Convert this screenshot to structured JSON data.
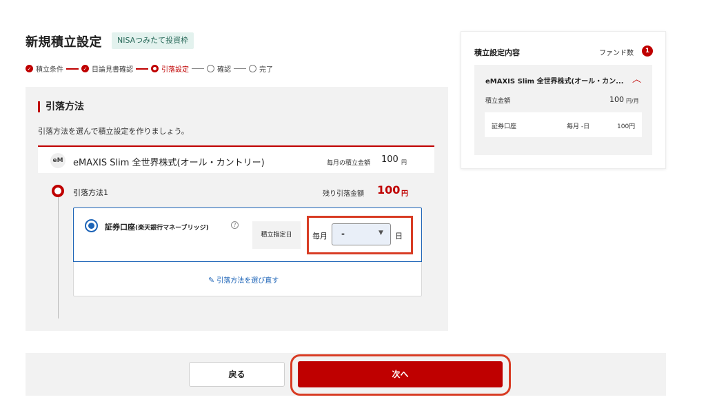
{
  "header": {
    "title": "新規積立設定",
    "badge": "NISAつみたて投資枠"
  },
  "steps": [
    {
      "label": "積立条件",
      "state": "done"
    },
    {
      "label": "目論見書確認",
      "state": "done"
    },
    {
      "label": "引落設定",
      "state": "current"
    },
    {
      "label": "確認",
      "state": "todo"
    },
    {
      "label": "完了",
      "state": "todo"
    }
  ],
  "section": {
    "heading": "引落方法",
    "description": "引落方法を選んで積立設定を作りましょう。"
  },
  "fund": {
    "avatar": "eM",
    "name": "eMAXIS Slim 全世界株式(オール・カントリー)",
    "amount_label": "毎月の積立金額",
    "amount": "100",
    "amount_unit": "円"
  },
  "method": {
    "label": "引落方法1",
    "remaining_label": "残り引落金額",
    "remaining_value": "100",
    "remaining_unit": "円",
    "account_name": "証券口座",
    "account_sub": "(楽天銀行マネーブリッジ)",
    "help_glyph": "?",
    "date_label": "積立指定日",
    "monthly_label": "毎月",
    "day_value": "-",
    "day_unit": "日",
    "reselect_link": "引落方法を選び直す"
  },
  "summary": {
    "title": "積立設定内容",
    "fund_count_label": "ファンド数",
    "fund_count": "1",
    "fund_name": "eMAXIS Slim 全世界株式(オール・カン...",
    "amount_label": "積立金額",
    "amount": "100",
    "amount_unit": "円/月",
    "account_name": "証券口座",
    "account_freq": "毎月  -日",
    "account_amount": "100円"
  },
  "footer": {
    "back_label": "戻る",
    "next_label": "次へ"
  },
  "colors": {
    "accent": "#bf0000",
    "link": "#1d64b7",
    "highlight": "#d83c24"
  },
  "icons": {
    "done": "check-circle-icon",
    "current": "current-step-icon",
    "todo": "empty-circle-icon",
    "edit": "pencil-icon",
    "collapse": "chevron-up-icon",
    "dropdown": "triangle-down-icon"
  }
}
